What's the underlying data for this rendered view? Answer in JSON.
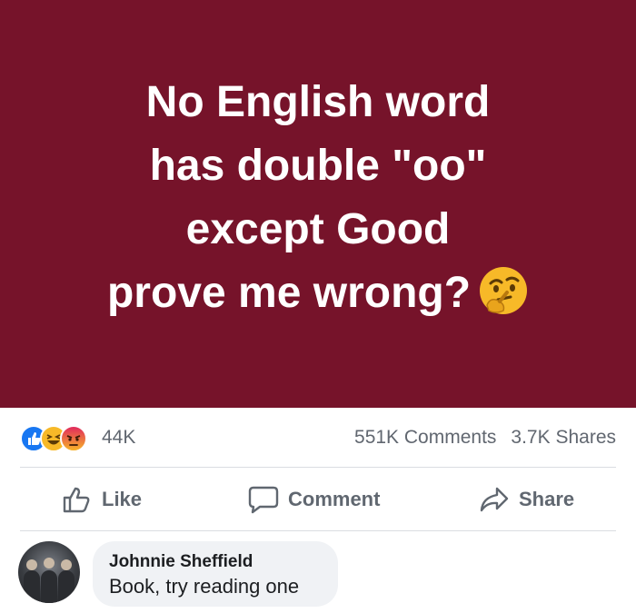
{
  "post": {
    "text_lines": [
      "No English word",
      "has double \"oo\"",
      "except Good",
      "prove me wrong?"
    ],
    "background_color": "#76132a",
    "emoji": "thinking-face"
  },
  "reactions": {
    "icons": [
      "like-reaction-icon",
      "haha-reaction-icon",
      "angry-reaction-icon"
    ],
    "count": "44K"
  },
  "stats": {
    "comments": "551K Comments",
    "shares": "3.7K Shares"
  },
  "actions": {
    "like": "Like",
    "comment": "Comment",
    "share": "Share"
  },
  "comment": {
    "author": "Johnnie Sheffield",
    "text": "Book, try reading one"
  },
  "colors": {
    "like_blue": "#1877f2",
    "haha_yellow": "#f7b928",
    "angry_red": "#e9710f",
    "meta_text": "#616770"
  }
}
